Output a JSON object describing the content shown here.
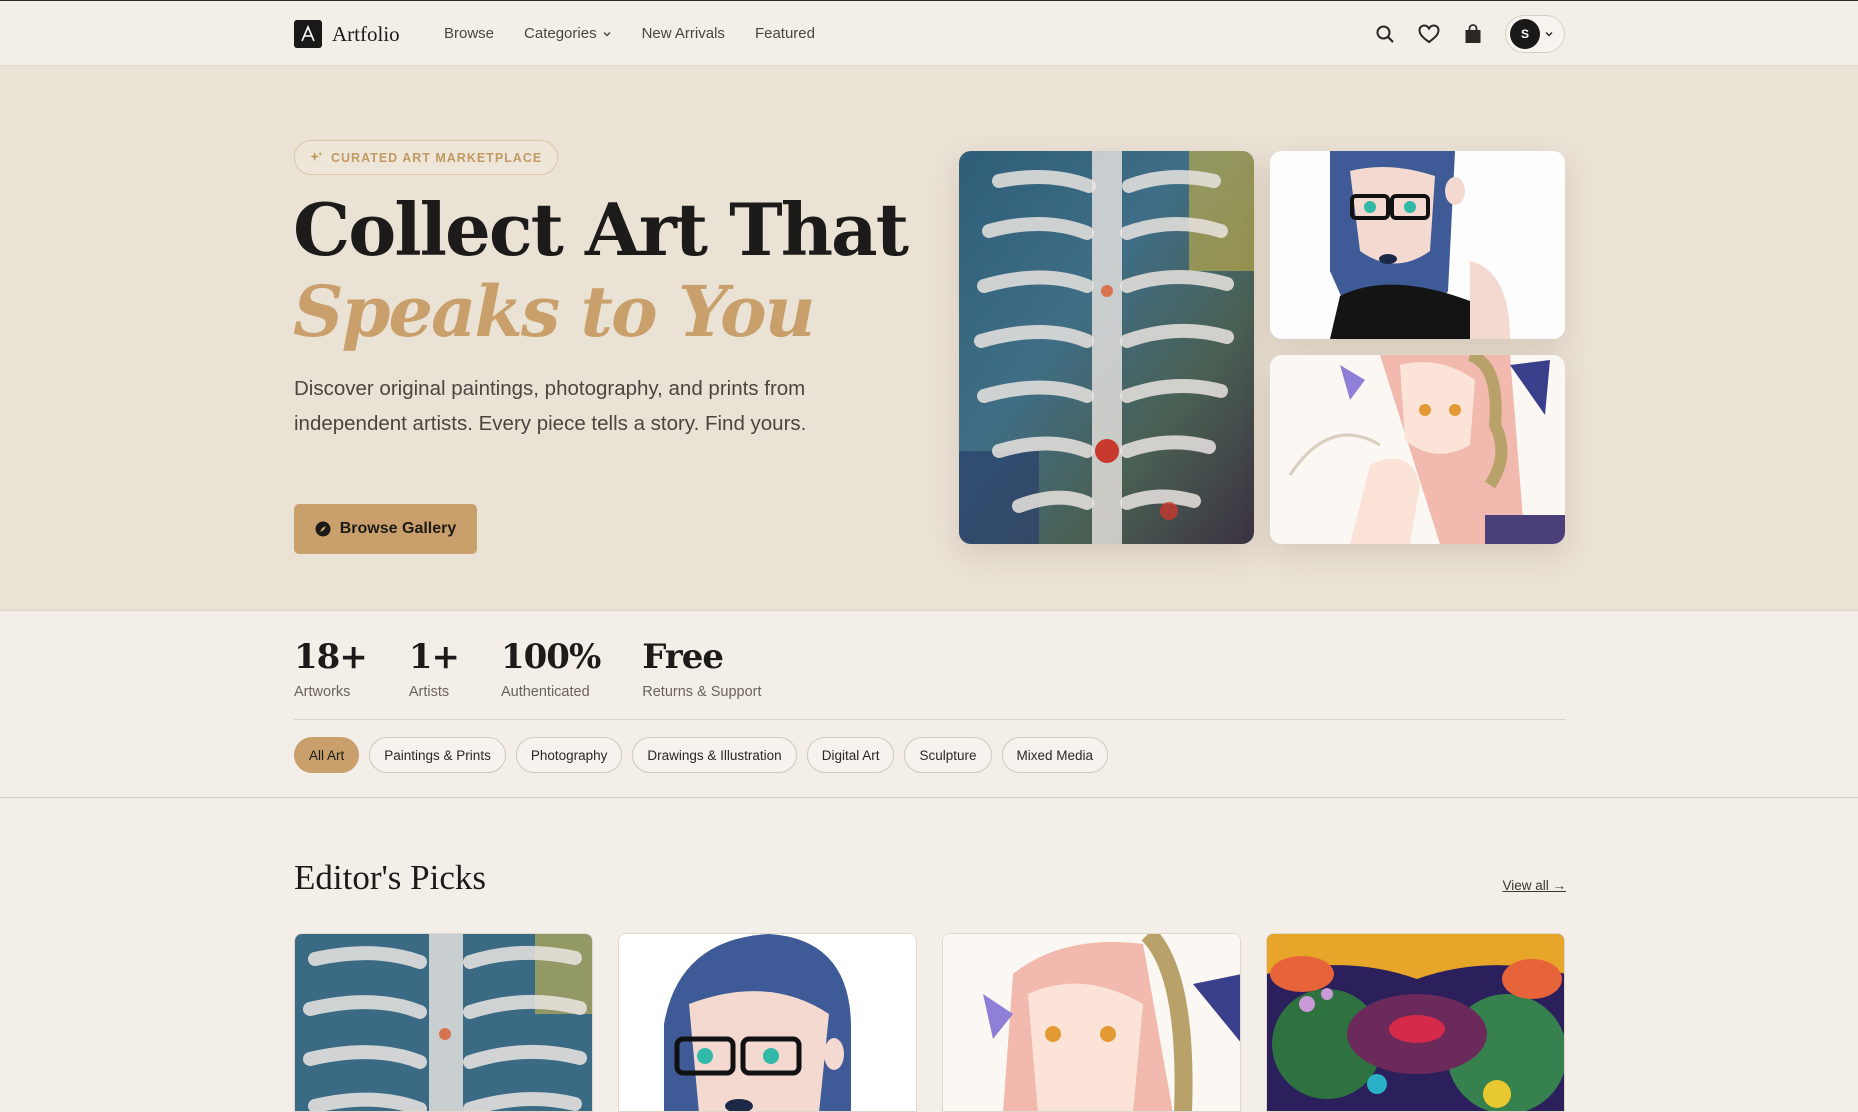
{
  "brand": {
    "name": "Artfolio"
  },
  "nav": {
    "links": [
      "Browse",
      "Categories",
      "New Arrivals",
      "Featured"
    ],
    "user_initial": "S"
  },
  "hero": {
    "badge": "CURATED ART MARKETPLACE",
    "title_line1": "Collect Art That",
    "title_line2": "Speaks to You",
    "description": "Discover original paintings, photography, and prints from independent artists. Every piece tells a story. Find yours.",
    "cta": "Browse Gallery"
  },
  "stats": [
    {
      "value": "18+",
      "label": "Artworks"
    },
    {
      "value": "1+",
      "label": "Artists"
    },
    {
      "value": "100%",
      "label": "Authenticated"
    },
    {
      "value": "Free",
      "label": "Returns & Support"
    }
  ],
  "filters": {
    "active": "All Art",
    "items": [
      "All Art",
      "Paintings & Prints",
      "Photography",
      "Drawings & Illustration",
      "Digital Art",
      "Sculpture",
      "Mixed Media"
    ]
  },
  "picks": {
    "title": "Editor's Picks",
    "view_all": "View all →"
  },
  "colors": {
    "accent": "#c9a06b",
    "hero_bg": "#ebe2d6",
    "page_bg": "#f3efe8",
    "dark": "#1a1918"
  }
}
